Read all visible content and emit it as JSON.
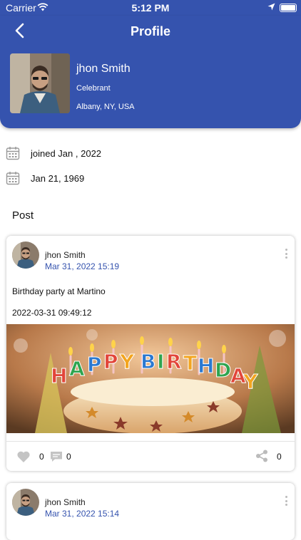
{
  "status_bar": {
    "carrier": "Carrier",
    "time": "5:12 PM"
  },
  "header": {
    "title": "Profile"
  },
  "profile": {
    "name": "jhon Smith",
    "role": "Celebrant",
    "location": "Albany, NY, USA",
    "joined": "joined Jan , 2022",
    "birthday": "Jan 21, 1969"
  },
  "section": {
    "title": "Post"
  },
  "posts": [
    {
      "author": "jhon Smith",
      "date": "Mar 31, 2022 15:19",
      "text": "Birthday party at Martino",
      "time": "2022-03-31 09:49:12",
      "likes": "0",
      "comments": "0",
      "shares": "0",
      "image_text": "HAPPY BIRTHDAY"
    },
    {
      "author": "jhon Smith",
      "date": "Mar 31, 2022 15:14"
    }
  ],
  "colors": {
    "primary": "#3553ae",
    "date_text": "#3553ae"
  }
}
